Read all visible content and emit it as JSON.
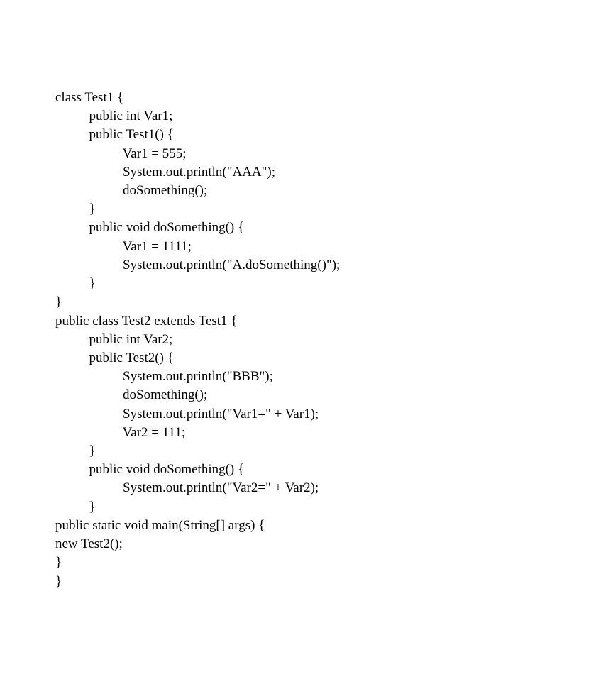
{
  "code": {
    "lines": [
      "class Test1 {",
      "          public int Var1;",
      "          public Test1() {",
      "                    Var1 = 555;",
      "                    System.out.println(\"AAA\");",
      "                    doSomething();",
      "          }",
      "          public void doSomething() {",
      "                    Var1 = 1111;",
      "                    System.out.println(\"A.doSomething()\");",
      "          }",
      "}",
      "public class Test2 extends Test1 {",
      "          public int Var2;",
      "          public Test2() {",
      "                    System.out.println(\"BBB\");",
      "                    doSomething();",
      "                    System.out.println(\"Var1=\" + Var1);",
      "                    Var2 = 111;",
      "          }",
      "          public void doSomething() {",
      "                    System.out.println(\"Var2=\" + Var2);",
      "          }",
      "public static void main(String[] args) {",
      "new Test2();",
      "}",
      "}"
    ]
  }
}
